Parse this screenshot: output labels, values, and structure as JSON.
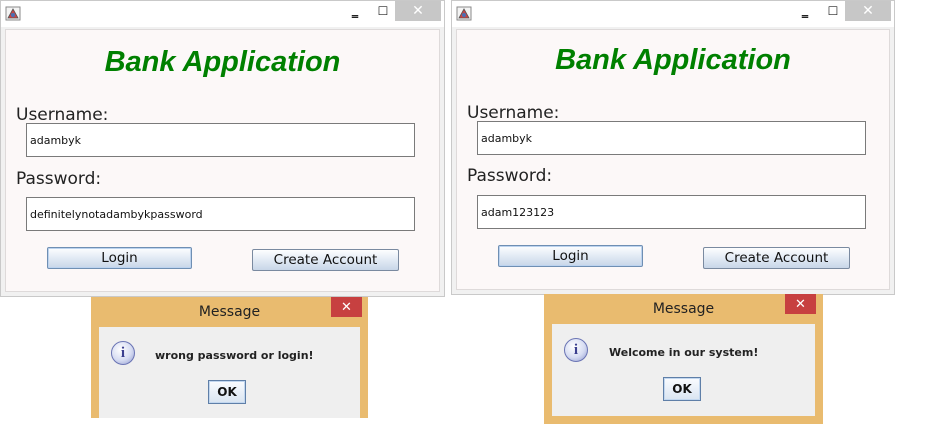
{
  "left_window": {
    "title_text": "Bank Application",
    "username_label": "Username:",
    "username_value": "adambyk",
    "password_label": "Password:",
    "password_value": "definitelynotadambykpassword",
    "login_label": "Login",
    "create_label": "Create Account",
    "minimize_glyph": "‗",
    "maximize_glyph": "☐",
    "close_glyph": "✕"
  },
  "right_window": {
    "title_text": "Bank Application",
    "username_label": "Username:",
    "username_value": "adambyk",
    "password_label": "Password:",
    "password_value": "adam123123",
    "login_label": "Login",
    "create_label": "Create Account",
    "minimize_glyph": "‗",
    "maximize_glyph": "☐",
    "close_glyph": "✕"
  },
  "left_dialog": {
    "title": "Message",
    "message": "wrong password or login!",
    "ok_label": "OK",
    "close_glyph": "✕",
    "icon": "info-icon"
  },
  "right_dialog": {
    "title": "Message",
    "message": "Welcome in our system!",
    "ok_label": "OK",
    "close_glyph": "✕",
    "icon": "info-icon"
  },
  "colors": {
    "title_green": "#008000",
    "dialog_frame": "#e9bb6f",
    "dialog_close": "#c74040"
  }
}
